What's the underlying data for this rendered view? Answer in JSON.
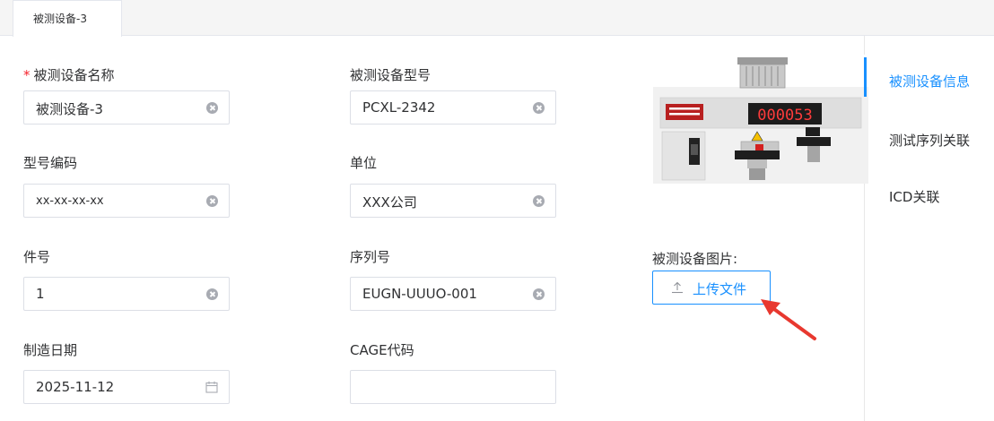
{
  "tab": {
    "label": "被测设备-3"
  },
  "form": {
    "device_name": {
      "label": "被测设备名称",
      "required_mark": "*",
      "value": "被测设备-3"
    },
    "device_model": {
      "label": "被测设备型号",
      "value": "PCXL-2342"
    },
    "model_code": {
      "label": "型号编码",
      "value": "xx-xx-xx-xx"
    },
    "unit": {
      "label": "单位",
      "value": "XXX公司"
    },
    "part_no": {
      "label": "件号",
      "value": "1"
    },
    "serial_no": {
      "label": "序列号",
      "value": "EUGN-UUUO-001"
    },
    "mfg_date": {
      "label": "制造日期",
      "value": "2025-11-12"
    },
    "cage_code": {
      "label": "CAGE代码",
      "value": ""
    }
  },
  "image_section": {
    "label": "被测设备图片:",
    "upload_label": "上传文件",
    "device_display": "000053"
  },
  "side_nav": {
    "items": [
      {
        "label": "被测设备信息",
        "active": true
      },
      {
        "label": "测试序列关联",
        "active": false
      },
      {
        "label": "ICD关联",
        "active": false
      }
    ]
  },
  "colors": {
    "accent": "#1890ff",
    "required": "#f5222d",
    "annotation_arrow": "#e8382f"
  }
}
